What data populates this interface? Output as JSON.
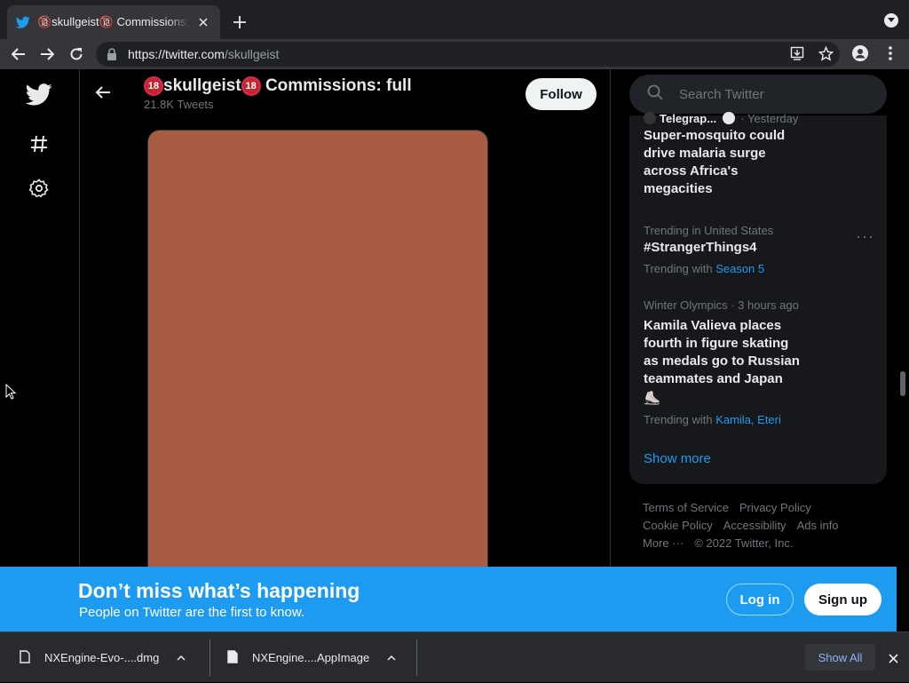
{
  "browser": {
    "tab_title": "🔞skullgeist🔞 Commissions: full",
    "url_host": "https://twitter.com",
    "url_path": "/skullgeist",
    "icons": [
      "twitter-bird-icon",
      "close-icon",
      "plus-icon",
      "tab-search-icon",
      "back-icon",
      "forward-icon",
      "reload-icon",
      "lock-icon",
      "install-icon",
      "star-icon",
      "profile-icon",
      "kebab-menu-icon"
    ]
  },
  "profile": {
    "badge": "18",
    "name": "skullgeist",
    "name_suffix": "Commissions: full",
    "tweet_count": "21.8K Tweets",
    "follow_label": "Follow",
    "media_color": "#a95c44"
  },
  "sidebar": {
    "search_placeholder": "Search Twitter",
    "trends": [
      {
        "meta_source": "Telegrap...",
        "meta_time": "· Yesterday",
        "title": "Super-mosquito could drive malaria surge across Africa's megacities"
      },
      {
        "meta": "Trending in United States",
        "title": "#StrangerThings4",
        "with_label": "Trending with",
        "with_link": "Season 5"
      },
      {
        "meta": "Winter Olympics · 3 hours ago",
        "title": "Kamila Valieva places fourth in figure skating as medals go to Russian teammates and Japan",
        "emoji": "⛸️",
        "with_label": "Trending with",
        "with_link": "Kamila, Eteri"
      }
    ],
    "show_more": "Show more",
    "footer": {
      "terms": "Terms of Service",
      "privacy": "Privacy Policy",
      "cookie": "Cookie Policy",
      "accessibility": "Accessibility",
      "ads": "Ads info",
      "more": "More ···",
      "copyright": "© 2022 Twitter, Inc."
    }
  },
  "banner": {
    "title": "Don’t miss what’s happening",
    "subtitle": "People on Twitter are the first to know.",
    "login": "Log in",
    "signup": "Sign up",
    "color": "#1d9bf0"
  },
  "downloads": {
    "items": [
      {
        "name": "NXEngine-Evo-....dmg"
      },
      {
        "name": "NXEngine....AppImage"
      }
    ],
    "show_all": "Show All"
  }
}
